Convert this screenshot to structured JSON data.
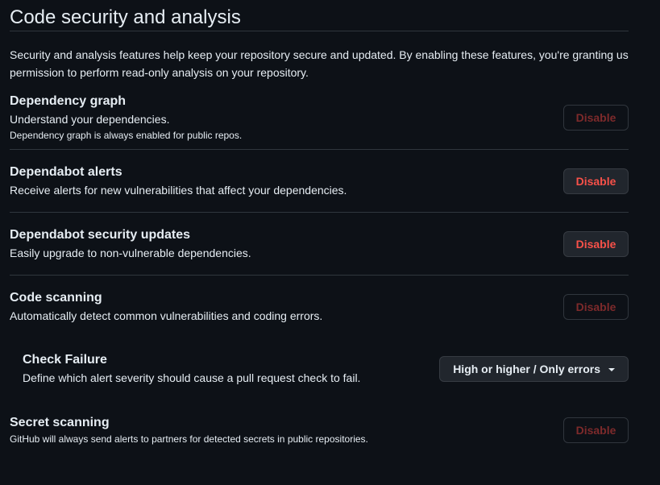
{
  "page": {
    "title": "Code security and analysis",
    "intro": "Security and analysis features help keep your repository secure and updated. By enabling these features, you're granting us permission to perform read-only analysis on your repository."
  },
  "features": {
    "dependency_graph": {
      "title": "Dependency graph",
      "description": "Understand your dependencies.",
      "note": "Dependency graph is always enabled for public repos.",
      "button_label": "Disable"
    },
    "dependabot_alerts": {
      "title": "Dependabot alerts",
      "description": "Receive alerts for new vulnerabilities that affect your dependencies.",
      "button_label": "Disable"
    },
    "dependabot_security_updates": {
      "title": "Dependabot security updates",
      "description": "Easily upgrade to non-vulnerable dependencies.",
      "button_label": "Disable"
    },
    "code_scanning": {
      "title": "Code scanning",
      "description": "Automatically detect common vulnerabilities and coding errors.",
      "button_label": "Disable"
    },
    "check_failure": {
      "title": "Check Failure",
      "description": "Define which alert severity should cause a pull request check to fail.",
      "selected_value": "High or higher / Only errors"
    },
    "secret_scanning": {
      "title": "Secret scanning",
      "description": "GitHub will always send alerts to partners for detected secrets in public repositories.",
      "button_label": "Disable"
    }
  },
  "colors": {
    "background": "#0d1117",
    "border": "#30363d",
    "danger_text": "#f85149",
    "danger_text_muted": "#7d2a2b",
    "button_bg": "#21262d"
  }
}
